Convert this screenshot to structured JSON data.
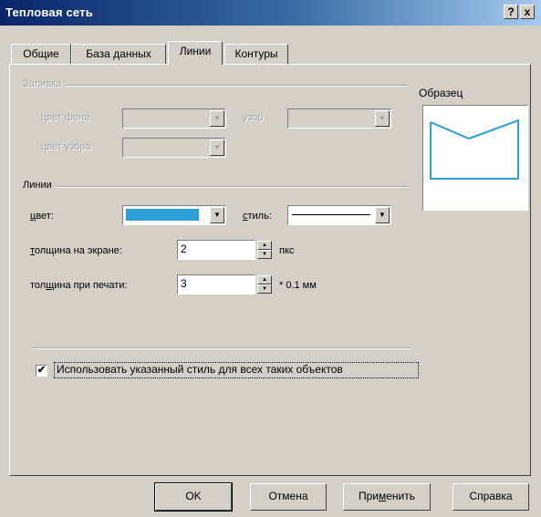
{
  "window": {
    "title": "Тепловая сеть",
    "help_glyph": "?",
    "close_glyph": "x"
  },
  "tabs": [
    {
      "label": "Общие",
      "active": false
    },
    {
      "label": "База данных",
      "active": false
    },
    {
      "label": "Линии",
      "active": true
    },
    {
      "label": "Контуры",
      "active": false
    }
  ],
  "fill_group": {
    "title": "Заливка",
    "bg_color_label": "цвет фона",
    "pattern_label": "узор",
    "pattern_color_label": "цвет узора"
  },
  "preview": {
    "title": "Образец",
    "line_color": "#2e9fd6"
  },
  "lines_group": {
    "title": "Линии",
    "color_label": "цвет:",
    "color_value": "#2e9fd6",
    "style_label": "стиль:",
    "screen_width_label": "толщина на экране:",
    "screen_width_value": "2",
    "screen_width_unit": "пкс",
    "print_width_label": "толщина при печати:",
    "print_width_value": "3",
    "print_width_unit": "* 0.1 мм"
  },
  "use_style_checkbox": {
    "label": "Использовать указанный стиль для всех таких объектов",
    "checked": true,
    "check_glyph": "✔"
  },
  "buttons": {
    "ok": "OK",
    "cancel": "Отмена",
    "apply": "Применить",
    "help": "Справка"
  },
  "glyphs": {
    "dropdown": "▼",
    "spin_up": "▲",
    "spin_down": "▼"
  }
}
